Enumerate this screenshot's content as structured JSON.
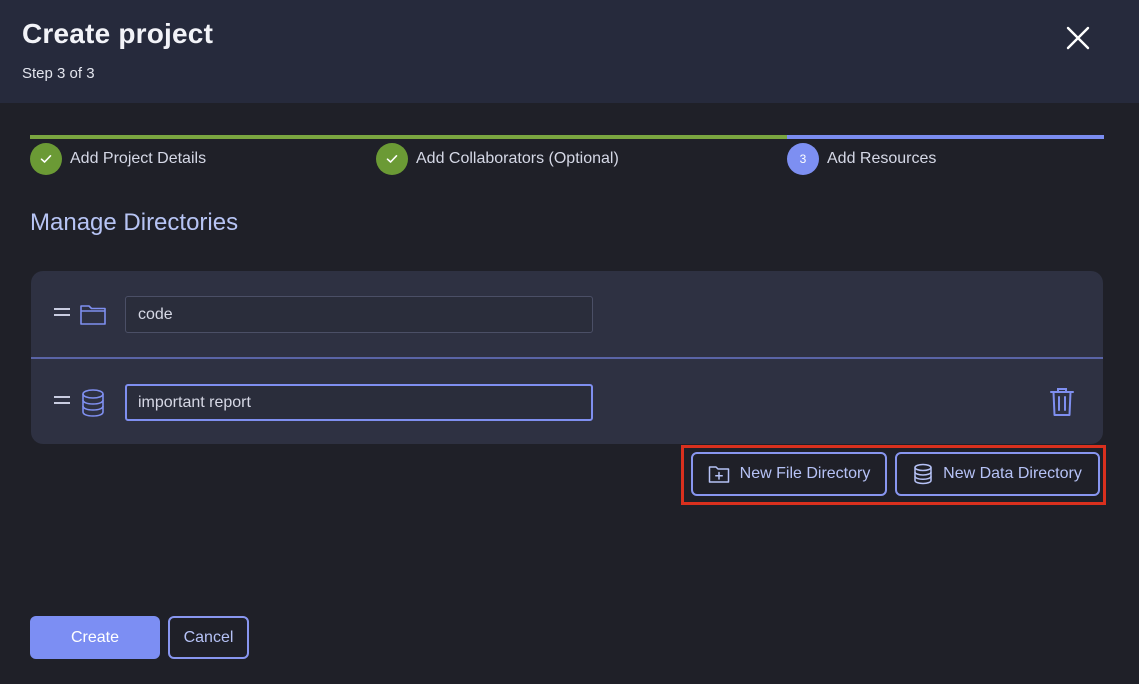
{
  "header": {
    "title": "Create project",
    "subtitle": "Step 3 of 3",
    "close_icon": "close-icon"
  },
  "stepper": {
    "progress": 0.705,
    "steps": [
      {
        "label": "Add Project Details",
        "status": "complete",
        "icon": "check-icon"
      },
      {
        "label": "Add Collaborators (Optional)",
        "status": "complete",
        "icon": "check-icon"
      },
      {
        "label": "Add Resources",
        "status": "current",
        "number": "3"
      }
    ]
  },
  "section": {
    "title": "Manage Directories"
  },
  "directories": [
    {
      "type": "file",
      "icon": "folder-icon",
      "value": "code",
      "focused": false
    },
    {
      "type": "data",
      "icon": "database-icon",
      "value": "important report",
      "focused": true
    }
  ],
  "actions": {
    "new_file_directory": "New File Directory",
    "new_data_directory": "New Data Directory",
    "create": "Create",
    "cancel": "Cancel"
  },
  "colors": {
    "background": "#1f2028",
    "header": "#262a3c",
    "accent": "#7c8ef3",
    "success": "#6b9a35",
    "highlight": "#d9301e"
  }
}
